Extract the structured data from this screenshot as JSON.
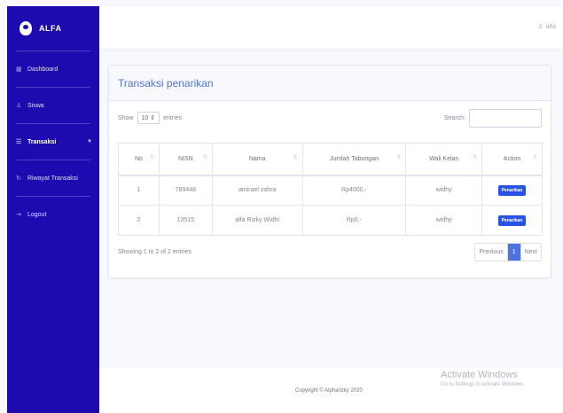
{
  "brand": {
    "name": "ALFA"
  },
  "sidebar": {
    "items": [
      {
        "label": "Dashboard",
        "icon": "dashboard-icon"
      },
      {
        "label": "Siswa",
        "icon": "user-icon"
      },
      {
        "label": "Transaksi",
        "icon": "list-icon",
        "active": true
      },
      {
        "label": "Riwayat Transaksi",
        "icon": "history-icon"
      },
      {
        "label": "Logout",
        "icon": "logout-icon"
      }
    ]
  },
  "topbar": {
    "user": "alfa"
  },
  "card": {
    "title": "Transaksi penarikan",
    "show_label": "Show",
    "show_value": "10",
    "entries_label": "entries",
    "search_label": "Search:",
    "search_value": "",
    "columns": [
      "No",
      "NISN",
      "Nama",
      "Jumlah Tabungan",
      "Wali Kelas",
      "Action"
    ],
    "rows": [
      {
        "no": "1",
        "nisn": "789448",
        "nama": "amirael zahra",
        "jumlah": "Rp4000,-",
        "wali": "widhy",
        "action": "Penarikan"
      },
      {
        "no": "2",
        "nisn": "13515",
        "nama": "alfa Rizky Widhi",
        "jumlah": "Rp0,-",
        "wali": "widhy",
        "action": "Penarikan"
      }
    ],
    "info": "Showing 1 to 2 of 2 entries",
    "pagination": {
      "previous": "Previous",
      "current": "1",
      "next": "Next"
    }
  },
  "footer": {
    "copyright": "Copyright © Alpharizky 2020"
  },
  "watermark": {
    "title": "Activate Windows",
    "subtitle": "Go to Settings to activate Windows."
  },
  "colors": {
    "sidebar": "#1e0bb0",
    "primary": "#4e73df",
    "button": "#2a52e6"
  }
}
